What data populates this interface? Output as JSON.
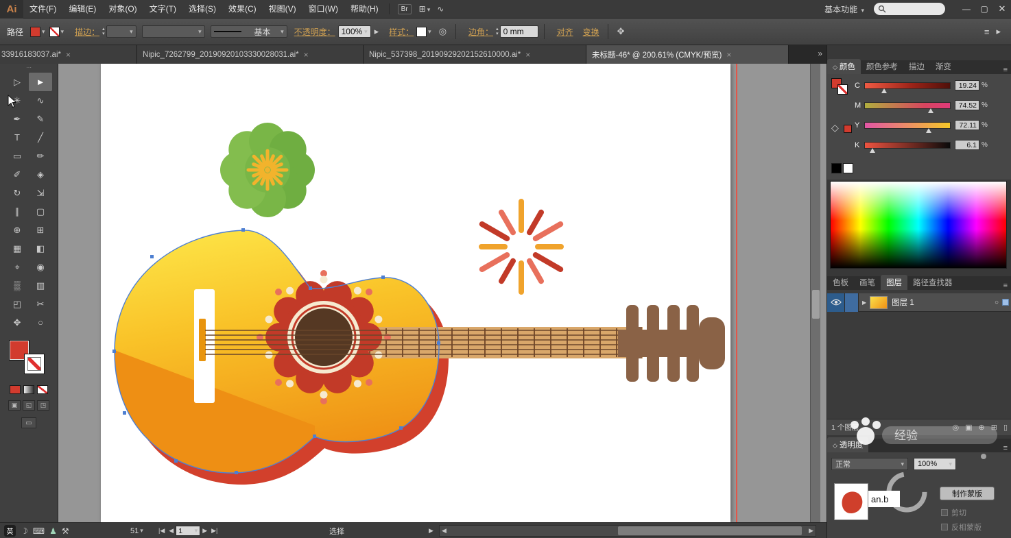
{
  "menu_bar": {
    "logo": "Ai",
    "items": [
      "文件(F)",
      "编辑(E)",
      "对象(O)",
      "文字(T)",
      "选择(S)",
      "效果(C)",
      "视图(V)",
      "窗口(W)",
      "帮助(H)"
    ],
    "bridge_button": "Br",
    "workspace_switcher": "基本功能"
  },
  "control_bar": {
    "context_label": "路径",
    "stroke_label": "描边：",
    "line_style": "基本",
    "opacity_label": "不透明度：",
    "opacity_value": "100%",
    "style_label": "样式：",
    "corner_label": "边角：",
    "corner_value": "0 mm",
    "align_label": "对齐",
    "transform_label": "变换"
  },
  "doc_tabs": [
    {
      "label": "33916183037.ai*",
      "close": "×"
    },
    {
      "label": "Nipic_7262799_20190920103330028031.ai*",
      "close": "×"
    },
    {
      "label": "Nipic_537398_20190929202152610000.ai*",
      "close": "×"
    },
    {
      "label": "未标题-46* @ 200.61% (CMYK/预览)",
      "close": "×"
    }
  ],
  "toolbar": {
    "tools": [
      {
        "name": "direct-selection-tool",
        "glyph": "▷"
      },
      {
        "name": "selection-tool",
        "glyph": "►",
        "active": true
      },
      {
        "name": "magic-wand-tool",
        "glyph": "✳"
      },
      {
        "name": "lasso-tool",
        "glyph": "∿"
      },
      {
        "name": "pen-tool",
        "glyph": "✒"
      },
      {
        "name": "curvature-tool",
        "glyph": "✎"
      },
      {
        "name": "type-tool",
        "glyph": "T"
      },
      {
        "name": "line-tool",
        "glyph": "╱"
      },
      {
        "name": "rectangle-tool",
        "glyph": "▭"
      },
      {
        "name": "paintbrush-tool",
        "glyph": "✏"
      },
      {
        "name": "pencil-tool",
        "glyph": "✐"
      },
      {
        "name": "shaper-tool",
        "glyph": "◈"
      },
      {
        "name": "rotate-tool",
        "glyph": "↻"
      },
      {
        "name": "scale-tool",
        "glyph": "⇲"
      },
      {
        "name": "width-tool",
        "glyph": "∥"
      },
      {
        "name": "free-transform-tool",
        "glyph": "▢"
      },
      {
        "name": "shape-builder-tool",
        "glyph": "⊕"
      },
      {
        "name": "perspective-grid-tool",
        "glyph": "⊞"
      },
      {
        "name": "mesh-tool",
        "glyph": "▦"
      },
      {
        "name": "gradient-tool",
        "glyph": "◧"
      },
      {
        "name": "eyedropper-tool",
        "glyph": "⌖"
      },
      {
        "name": "blend-tool",
        "glyph": "◉"
      },
      {
        "name": "symbol-sprayer-tool",
        "glyph": "▒"
      },
      {
        "name": "graph-tool",
        "glyph": "▥"
      },
      {
        "name": "artboard-tool",
        "glyph": "◰"
      },
      {
        "name": "slice-tool",
        "glyph": "✂"
      },
      {
        "name": "hand-tool",
        "glyph": "✥"
      },
      {
        "name": "zoom-tool",
        "glyph": "○"
      }
    ]
  },
  "color_panel": {
    "tabs": [
      "颜色",
      "颜色参考",
      "描边",
      "渐变"
    ],
    "channels": [
      {
        "label": "C",
        "value": "19.24"
      },
      {
        "label": "M",
        "value": "74.52"
      },
      {
        "label": "Y",
        "value": "72.11"
      },
      {
        "label": "K",
        "value": "6.1"
      }
    ],
    "unit": "%"
  },
  "panel_group2": {
    "tabs": [
      "色板",
      "画笔",
      "图层",
      "路径查找器"
    ]
  },
  "layers_panel": {
    "layer_name": "图层 1",
    "footer_count": "1 个图层"
  },
  "transparency_panel": {
    "title": "透明度",
    "blend_mode": "正常",
    "opacity": "100%",
    "make_mask_button": "制作蒙版",
    "clip_label": "剪切",
    "invert_mask_label": "反相蒙版"
  },
  "status_bar": {
    "ime_badge": "英",
    "zoom_value": "51",
    "page_value": "1",
    "tool_status": "选择",
    "nav": {
      "first": "|◀",
      "prev": "◀",
      "next": "▶",
      "last": "▶|"
    }
  },
  "watermark": {
    "text_fragment": "an.b"
  },
  "icons": {
    "dropdown": "▾",
    "stepper_up": "▴",
    "stepper_down": "▾",
    "menu": "≡",
    "overflow": "»",
    "recolor": "◎",
    "arrow_right": "▸",
    "scroll_left": "◀",
    "scroll_right": "▶",
    "diamond": "◇",
    "cube": "◇",
    "minimize": "—",
    "restore": "▢",
    "close": "✕",
    "grip": "⋯",
    "moon": "☽",
    "keyboard": "⌨",
    "person": "♟",
    "wrench": "⚒",
    "expand_chevron": "▶",
    "target": "○",
    "arrange": "⊞",
    "transform_icon": "✥",
    "locate": "◎",
    "clip_mask": "▣",
    "new_sublayer": "⊕",
    "new_layer": "⊞",
    "delete": "▯"
  },
  "artwork_colors": {
    "body_gradient_top": "#fde84a",
    "body_gradient_bottom": "#ef9115",
    "body_flat_orange": "#ee8f14",
    "body_shadow_red": "#d2402c",
    "neck_tan": "#d9a76a",
    "fret_brown": "#7a4e2c",
    "string_brown": "#6a462b",
    "headstock_brown": "#8a6246",
    "soundhole_brown": "#553823",
    "rosette_red": "#c23a28",
    "rosette_cream": "#f6ead0",
    "flower_green_light": "#83bd4e",
    "flower_green_dark": "#6fae41",
    "flower_center_orange": "#f2b32c",
    "burst_orange": "#f0a32c",
    "burst_red": "#c23a28",
    "burst_salmon": "#e8705c",
    "selection_blue": "#4d7fd2"
  }
}
